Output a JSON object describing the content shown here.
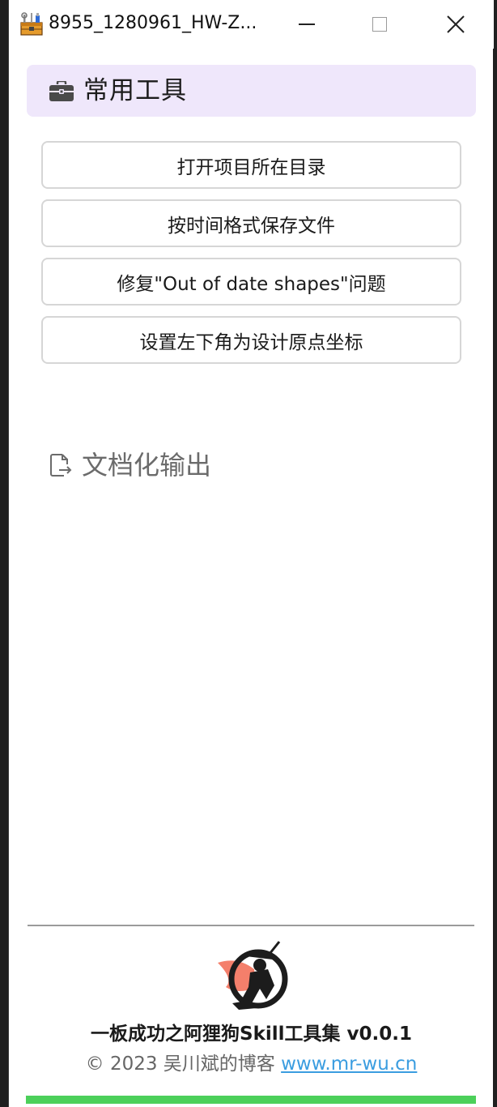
{
  "window": {
    "title": "8955_1280961_HW-Z...",
    "minimize_label": "",
    "close_label": "✕"
  },
  "section": {
    "title": "常用工具",
    "icon": "briefcase-icon"
  },
  "tools": [
    {
      "label": "打开项目所在目录"
    },
    {
      "label": "按时间格式保存文件"
    },
    {
      "label": "修复\"Out of date shapes\"问题"
    },
    {
      "label": "设置左下角为设计原点坐标"
    }
  ],
  "doc_output": {
    "label": "文档化输出",
    "icon": "file-export-icon"
  },
  "footer": {
    "product": "一板成功之阿狸狗Skill工具集 v0.0.1",
    "copyright": "© 2023 吴川斌的博客",
    "link": "www.mr-wu.cn",
    "progress": 1.0
  },
  "colors": {
    "header_bg": "#efe7fb",
    "link": "#3b9de0",
    "progress": "#4cd05a"
  }
}
